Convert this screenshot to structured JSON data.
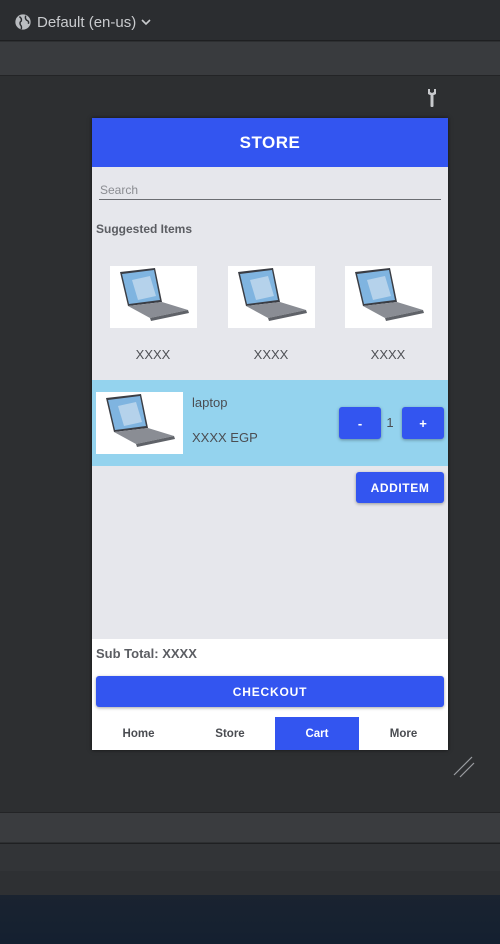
{
  "ide": {
    "locale_label": "Default (en-us)",
    "icons": {
      "locale": "globe-icon",
      "dropdown": "chevron-down-icon",
      "tool": "wrench-icon",
      "resize": "resize-grip-icon"
    }
  },
  "app": {
    "header_title": "STORE",
    "search_placeholder": "Search",
    "suggested_title": "Suggested Items",
    "suggested_items": [
      {
        "caption": "XXXX"
      },
      {
        "caption": "XXXX"
      },
      {
        "caption": "XXXX"
      }
    ],
    "cart_item": {
      "name": "laptop",
      "price": "XXXX EGP",
      "quantity": "1",
      "decrement_label": "-",
      "increment_label": "+"
    },
    "add_item_label": "ADDITEM",
    "subtotal_label": "Sub Total: XXXX",
    "checkout_label": "CHECKOUT",
    "tabs": [
      {
        "label": "Home",
        "active": false
      },
      {
        "label": "Store",
        "active": false
      },
      {
        "label": "Cart",
        "active": true
      },
      {
        "label": "More",
        "active": false
      }
    ],
    "colors": {
      "primary": "#3355f0",
      "cart_row_bg": "#94d3ee",
      "body_bg": "#e6e7ec"
    }
  }
}
